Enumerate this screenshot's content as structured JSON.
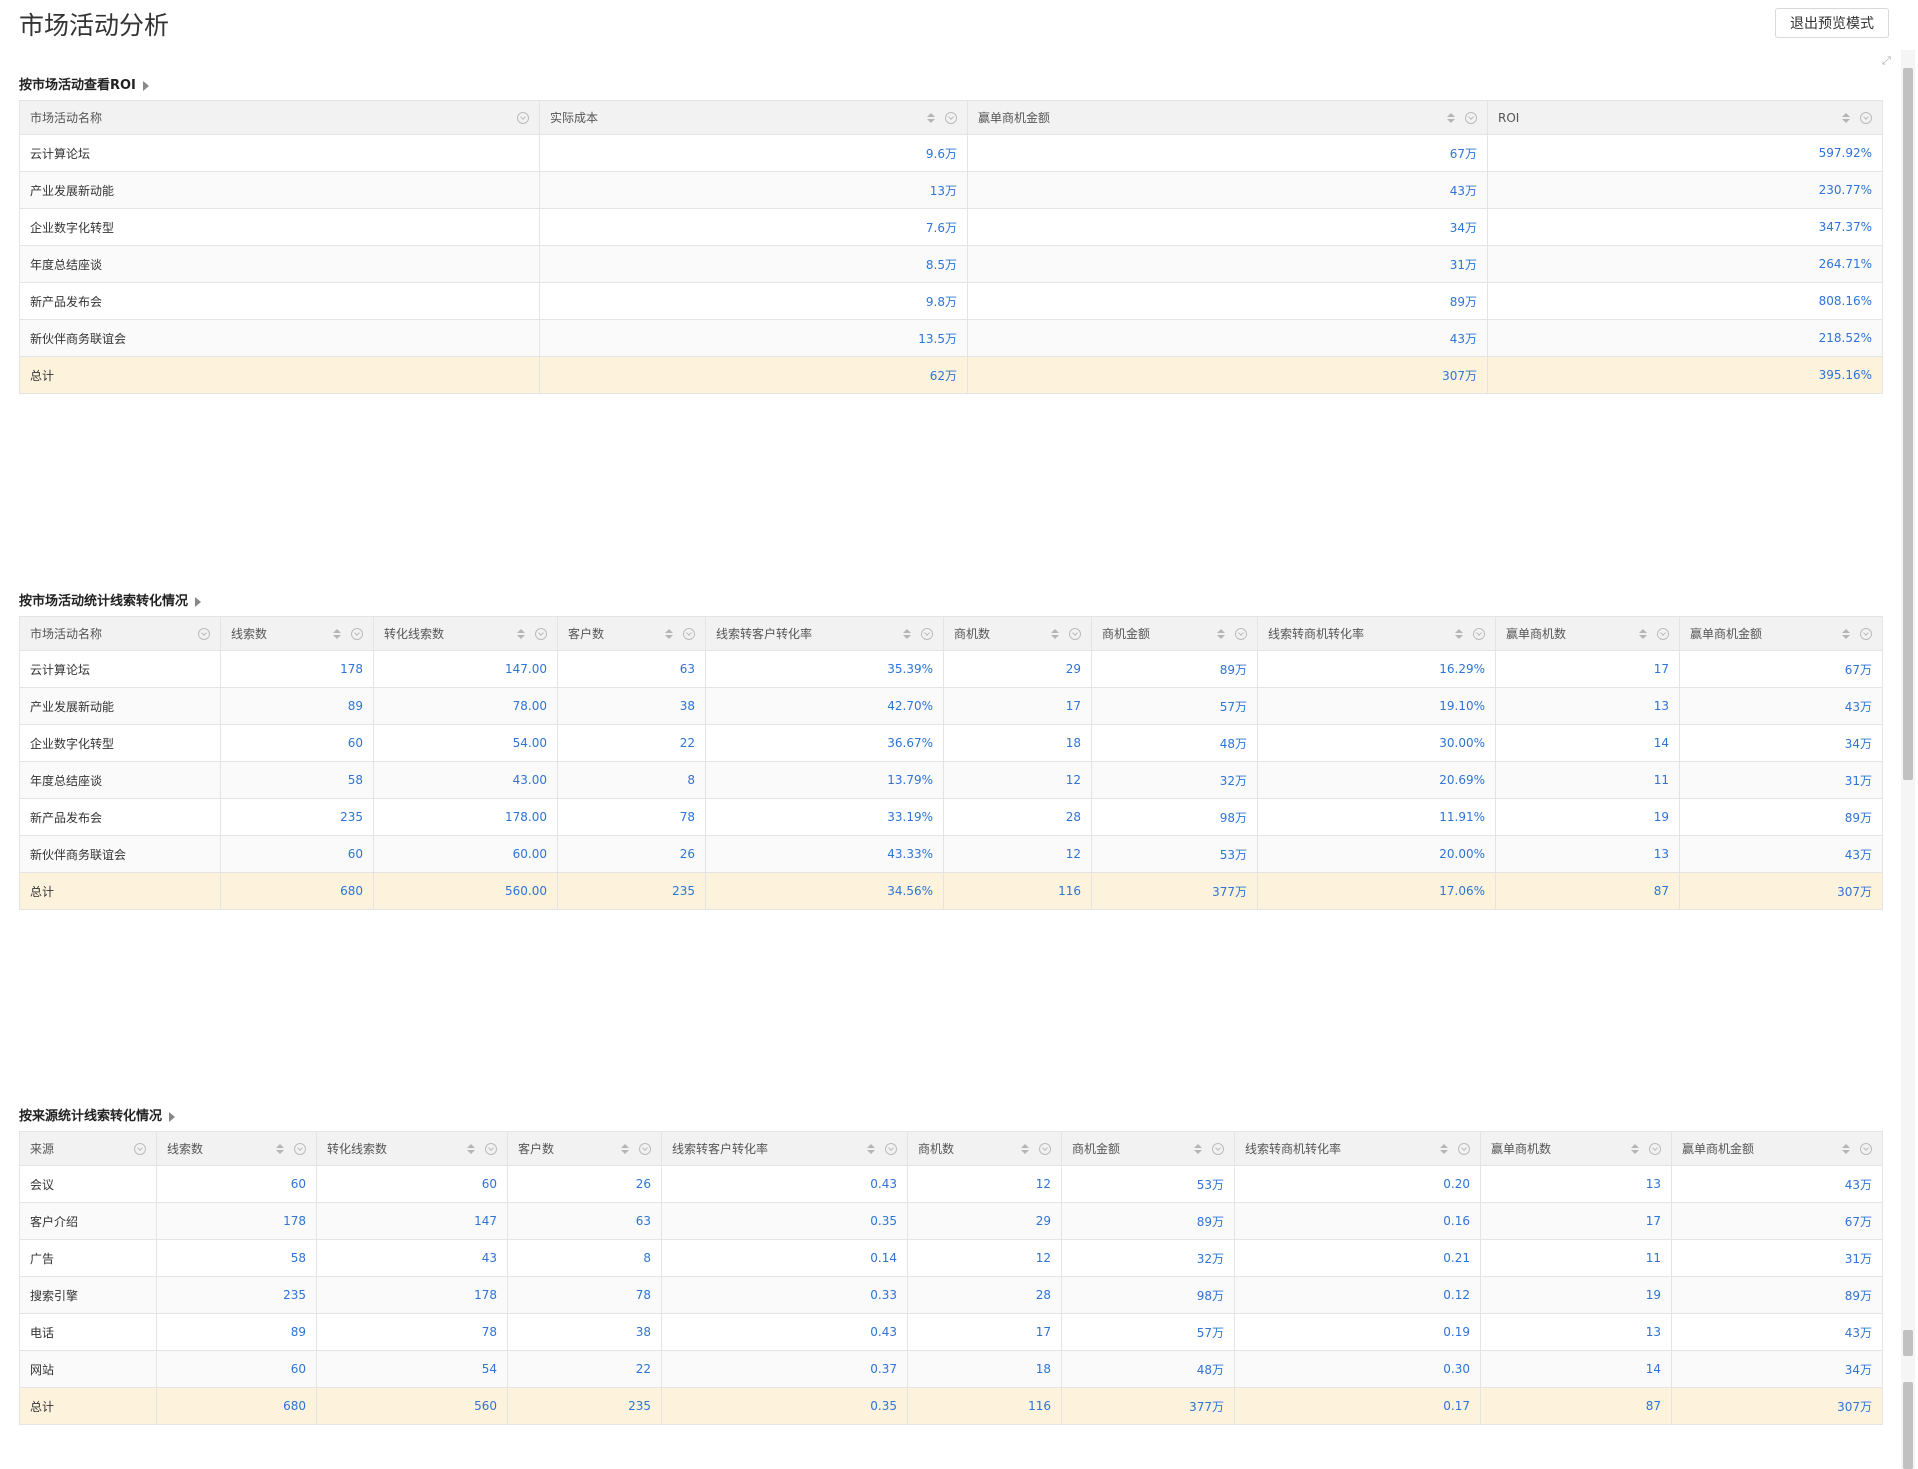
{
  "page": {
    "title": "市场活动分析",
    "exit_label": "退出预览模式"
  },
  "sections": [
    {
      "title": "按市场活动查看ROI",
      "columns": [
        "市场活动名称",
        "实际成本",
        "赢单商机金额",
        "ROI"
      ],
      "rows": [
        [
          "云计算论坛",
          "9.6万",
          "67万",
          "597.92%"
        ],
        [
          "产业发展新动能",
          "13万",
          "43万",
          "230.77%"
        ],
        [
          "企业数字化转型",
          "7.6万",
          "34万",
          "347.37%"
        ],
        [
          "年度总结座谈",
          "8.5万",
          "31万",
          "264.71%"
        ],
        [
          "新产品发布会",
          "9.8万",
          "89万",
          "808.16%"
        ],
        [
          "新伙伴商务联谊会",
          "13.5万",
          "43万",
          "218.52%"
        ]
      ],
      "total": [
        "总计",
        "62万",
        "307万",
        "395.16%"
      ]
    },
    {
      "title": "按市场活动统计线索转化情况",
      "columns": [
        "市场活动名称",
        "线索数",
        "转化线索数",
        "客户数",
        "线索转客户转化率",
        "商机数",
        "商机金额",
        "线索转商机转化率",
        "赢单商机数",
        "赢单商机金额"
      ],
      "rows": [
        [
          "云计算论坛",
          "178",
          "147.00",
          "63",
          "35.39%",
          "29",
          "89万",
          "16.29%",
          "17",
          "67万"
        ],
        [
          "产业发展新动能",
          "89",
          "78.00",
          "38",
          "42.70%",
          "17",
          "57万",
          "19.10%",
          "13",
          "43万"
        ],
        [
          "企业数字化转型",
          "60",
          "54.00",
          "22",
          "36.67%",
          "18",
          "48万",
          "30.00%",
          "14",
          "34万"
        ],
        [
          "年度总结座谈",
          "58",
          "43.00",
          "8",
          "13.79%",
          "12",
          "32万",
          "20.69%",
          "11",
          "31万"
        ],
        [
          "新产品发布会",
          "235",
          "178.00",
          "78",
          "33.19%",
          "28",
          "98万",
          "11.91%",
          "19",
          "89万"
        ],
        [
          "新伙伴商务联谊会",
          "60",
          "60.00",
          "26",
          "43.33%",
          "12",
          "53万",
          "20.00%",
          "13",
          "43万"
        ]
      ],
      "total": [
        "总计",
        "680",
        "560.00",
        "235",
        "34.56%",
        "116",
        "377万",
        "17.06%",
        "87",
        "307万"
      ]
    },
    {
      "title": "按来源统计线索转化情况",
      "columns": [
        "来源",
        "线索数",
        "转化线索数",
        "客户数",
        "线索转客户转化率",
        "商机数",
        "商机金额",
        "线索转商机转化率",
        "赢单商机数",
        "赢单商机金额"
      ],
      "rows": [
        [
          "会议",
          "60",
          "60",
          "26",
          "0.43",
          "12",
          "53万",
          "0.20",
          "13",
          "43万"
        ],
        [
          "客户介绍",
          "178",
          "147",
          "63",
          "0.35",
          "29",
          "89万",
          "0.16",
          "17",
          "67万"
        ],
        [
          "广告",
          "58",
          "43",
          "8",
          "0.14",
          "12",
          "32万",
          "0.21",
          "11",
          "31万"
        ],
        [
          "搜索引擎",
          "235",
          "178",
          "78",
          "0.33",
          "28",
          "98万",
          "0.12",
          "19",
          "89万"
        ],
        [
          "电话",
          "89",
          "78",
          "38",
          "0.43",
          "17",
          "57万",
          "0.19",
          "13",
          "43万"
        ],
        [
          "网站",
          "60",
          "54",
          "22",
          "0.37",
          "18",
          "48万",
          "0.30",
          "14",
          "34万"
        ]
      ],
      "total": [
        "总计",
        "680",
        "560",
        "235",
        "0.35",
        "116",
        "377万",
        "0.17",
        "87",
        "307万"
      ]
    }
  ]
}
